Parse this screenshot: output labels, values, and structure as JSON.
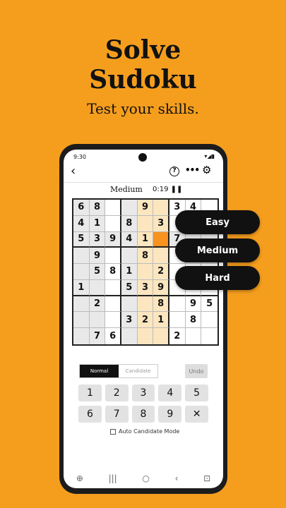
{
  "promo": {
    "headline_line1": "Solve",
    "headline_line2": "Sudoku",
    "tagline": "Test your skills."
  },
  "status_bar": {
    "time": "9:30",
    "icons": "▾◢▮"
  },
  "toolbar": {
    "back_icon": "‹",
    "help_icon": "?",
    "more_icon": "•••",
    "settings_icon": "⚙"
  },
  "game": {
    "level": "Medium",
    "timer": "0:19 ❚❚"
  },
  "grid": [
    [
      "6",
      "8",
      "",
      "",
      "9",
      "",
      "3",
      "4",
      ""
    ],
    [
      "4",
      "1",
      "",
      "8",
      "",
      "3",
      "",
      "",
      ""
    ],
    [
      "5",
      "3",
      "9",
      "4",
      "1",
      "",
      "7",
      "",
      ""
    ],
    [
      "",
      "9",
      "",
      "",
      "8",
      "",
      "",
      "",
      ""
    ],
    [
      "",
      "5",
      "8",
      "1",
      "",
      "2",
      "",
      "",
      ""
    ],
    [
      "1",
      "",
      "",
      "5",
      "3",
      "9",
      "",
      "",
      ""
    ],
    [
      "",
      "2",
      "",
      "",
      "",
      "8",
      "",
      "9",
      "5"
    ],
    [
      "",
      "",
      "",
      "3",
      "2",
      "1",
      "",
      "8",
      ""
    ],
    [
      "",
      "7",
      "6",
      "",
      "",
      "",
      "2",
      "",
      ""
    ]
  ],
  "difficulty_menu": [
    "Easy",
    "Medium",
    "Hard"
  ],
  "modes": {
    "normal": "Normal",
    "candidate": "Candidate",
    "undo": "Undo"
  },
  "keypad": [
    "1",
    "2",
    "3",
    "4",
    "5",
    "6",
    "7",
    "8",
    "9",
    "✕"
  ],
  "auto_candidate_label": "Auto Candidate Mode",
  "navbar": {
    "assist_icon": "⊕",
    "recents_icon": "|||",
    "home_icon": "○",
    "back_icon": "‹",
    "screenshot_icon": "⊡"
  },
  "colors": {
    "background": "#F59E1E",
    "selected_cell": "#F7931E",
    "column_highlight": "#FBE6BF",
    "box_highlight": "#E9E9E9"
  }
}
